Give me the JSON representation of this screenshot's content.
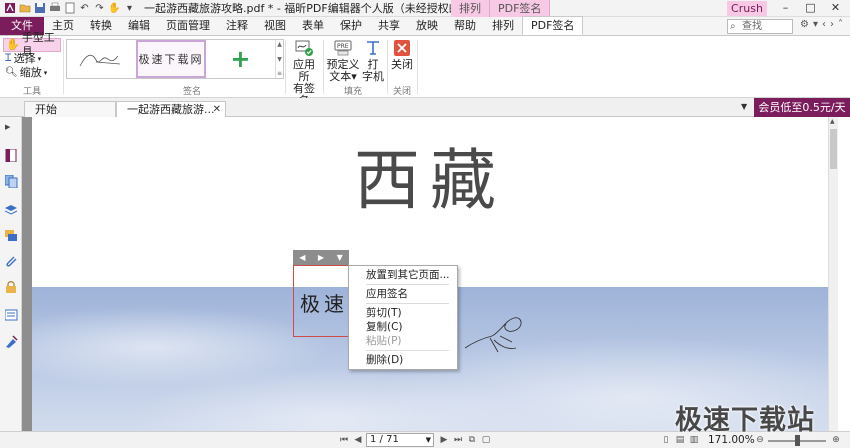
{
  "window": {
    "title": "一起游西藏旅游攻略.pdf * - 福昕PDF编辑器个人版（未经授权的产品）",
    "context_tabs": [
      "排列",
      "PDF签名"
    ],
    "user": "Crush",
    "controls": [
      "–",
      "□",
      "✕"
    ]
  },
  "menu": {
    "file": "文件",
    "tabs": [
      "主页",
      "转换",
      "编辑",
      "页面管理",
      "注释",
      "视图",
      "表单",
      "保护",
      "共享",
      "放映",
      "帮助",
      "排列",
      "PDF签名"
    ],
    "search_placeholder": "查找"
  },
  "ribbon": {
    "tools": {
      "hand": "手型工具",
      "select": "选择",
      "zoom": "缩放",
      "group": "工具"
    },
    "signature": {
      "picked_text": "极速下载网",
      "add": "+",
      "group": "签名"
    },
    "apply_all": "应用所有签名",
    "predefined": "预定义文本",
    "typewriter": "打字机",
    "fill_group": "填充",
    "close": "关闭",
    "close_group": "关闭",
    "apply_all_l1": "应用所",
    "apply_all_l2": "有签名",
    "predefined_l1": "预定义",
    "predefined_l2": "文本",
    "typewriter_l1": "打",
    "typewriter_l2": "字机"
  },
  "doc_tabs": {
    "start": "开始",
    "current": "一起游西藏旅游...",
    "vip": "会员低至0.5元/天"
  },
  "page": {
    "title": "西藏",
    "signature_text": "极速"
  },
  "context_menu": {
    "items": [
      "放置到其它页面...",
      "应用签名",
      "剪切(T)",
      "复制(C)",
      "粘贴(P)",
      "删除(D)"
    ]
  },
  "status": {
    "page": "1 / 71",
    "zoom": "171.00%"
  },
  "watermark": "极速下载站"
}
